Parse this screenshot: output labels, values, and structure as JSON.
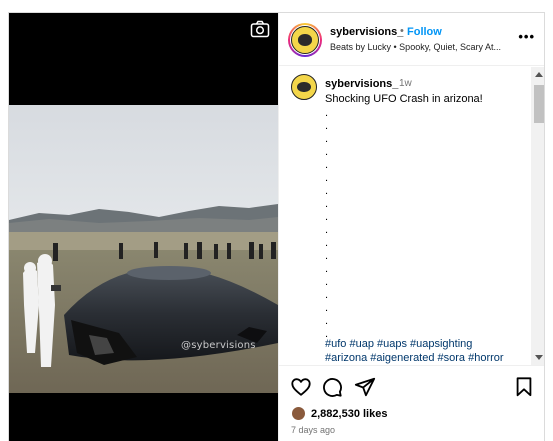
{
  "post": {
    "username": "sybervisions_",
    "separator": "•",
    "follow_label": "Follow",
    "audio": "Beats by Lucky • Spooky, Quiet, Scary At...",
    "more_label": "•••",
    "watermark": "@sybervisions"
  },
  "caption": {
    "username": "sybervisions_",
    "time": "1w",
    "text": "Shocking UFO Crash in arizona!",
    "dots": ".\n.\n.\n.\n.\n.\n.\n.\n.\n.\n.\n.\n.\n.\n.\n.\n.\n.",
    "hashtags_line1": "#ufo #uap #uaps #uapsighting",
    "hashtags_line2": "#arizona #aigenerated #sora #horror"
  },
  "engagement": {
    "likes": "2,882,530 likes",
    "age": "7 days ago"
  },
  "icons": [
    "camera-icon",
    "heart-icon",
    "comment-icon",
    "share-icon",
    "bookmark-icon",
    "more-icon"
  ],
  "colors": {
    "follow": "#0095f6",
    "hashtag": "#00376b",
    "muted": "#737373"
  }
}
